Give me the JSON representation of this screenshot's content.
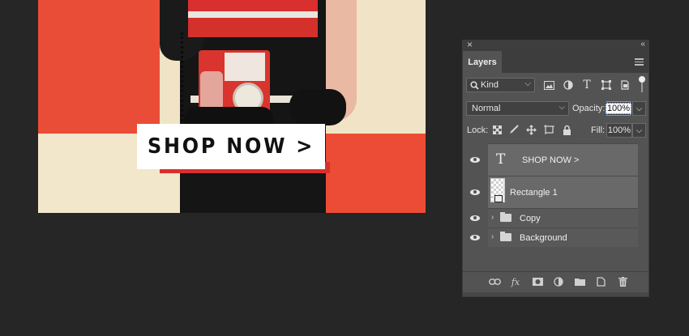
{
  "canvas": {
    "shop_label": "SHOP NOW >"
  },
  "panel": {
    "title": "Layers",
    "filter": {
      "kind_label": "Kind",
      "icons": [
        "image-filter-icon",
        "adjustment-filter-icon",
        "type-filter-icon",
        "shape-filter-icon",
        "smart-object-filter-icon"
      ]
    },
    "blend_mode": "Normal",
    "opacity_label": "Opacity:",
    "opacity_value": "100%",
    "lock_label": "Lock:",
    "fill_label": "Fill:",
    "fill_value": "100%",
    "layers": [
      {
        "name": "SHOP NOW >",
        "type": "text",
        "visible": true
      },
      {
        "name": "Rectangle 1",
        "type": "shape",
        "visible": true
      },
      {
        "name": "Copy",
        "type": "group",
        "visible": true
      },
      {
        "name": "Background",
        "type": "group",
        "visible": true
      }
    ],
    "bottom_icons": [
      "link-layers-icon",
      "fx-icon",
      "layer-mask-icon",
      "adjustment-layer-icon",
      "new-group-icon",
      "new-layer-icon",
      "delete-layer-icon"
    ]
  },
  "colors": {
    "app_bg": "#262626",
    "panel_bg": "#535353",
    "selected_layer": "#696969",
    "accent_red": "#ea4d37"
  }
}
